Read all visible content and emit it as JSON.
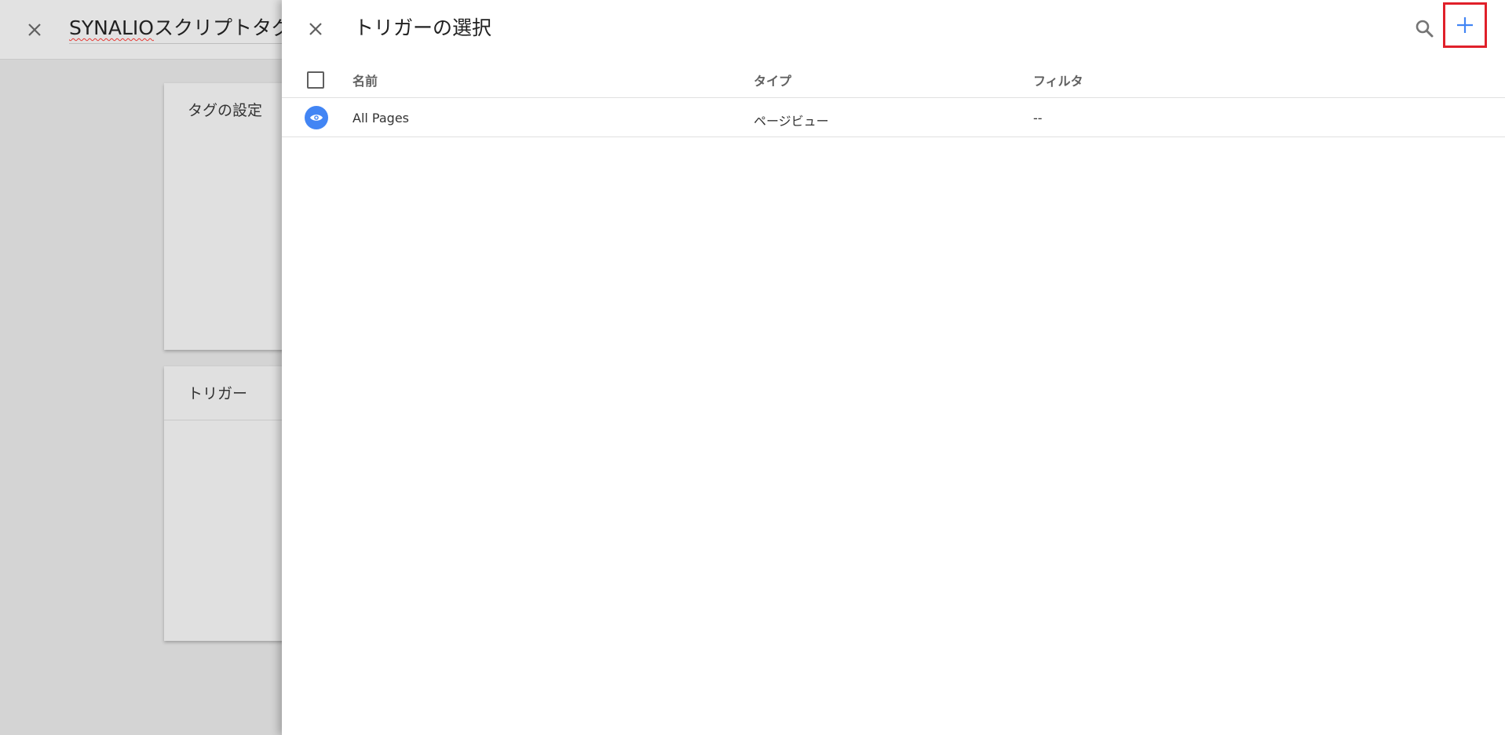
{
  "background": {
    "title_marked": "SYNALIO",
    "title_rest": "スクリプトタグ",
    "cards": {
      "tag_settings_title": "タグの設定",
      "trigger_title": "トリガー"
    }
  },
  "panel": {
    "title": "トリガーの選択",
    "icons": {
      "close": "close-icon",
      "search": "search-icon",
      "add": "plus-icon"
    },
    "add_highlight_color": "#e0202a",
    "accent_color": "#4285f4"
  },
  "table": {
    "columns": [
      "名前",
      "タイプ",
      "フィルタ"
    ],
    "rows": [
      {
        "icon": "eye-icon",
        "name": "All Pages",
        "type": "ページビュー",
        "filter": "--"
      }
    ]
  }
}
